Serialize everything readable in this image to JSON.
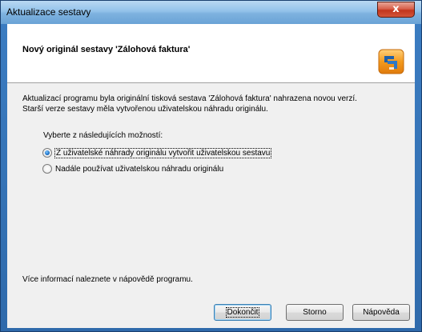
{
  "window": {
    "title": "Aktualizace sestavy",
    "close_glyph": "x"
  },
  "header": {
    "title": "Nový originál sestavy 'Zálohová faktura'",
    "logo_icon": "app-logo-icon"
  },
  "message": {
    "line1": "Aktualizací programu byla originální tisková sestava 'Zálohová faktura' nahrazena novou verzí.",
    "line2": "Starší verze sestavy měla vytvořenou uživatelskou náhradu originálu."
  },
  "options": {
    "label": "Vyberte z následujících možností:",
    "items": [
      {
        "label": "Z uživatelské náhrady originálu vytvořit uživatelskou sestavu",
        "selected": true
      },
      {
        "label": "Nadále používat uživatelskou náhradu originálu",
        "selected": false
      }
    ]
  },
  "info": "Více informací naleznete v nápovědě programu.",
  "buttons": {
    "finish": "Dokončit",
    "cancel": "Storno",
    "help": "Nápověda"
  },
  "colors": {
    "title_bar": "#7eb2df",
    "close_button": "#c2351c",
    "logo_orange": "#f39a1e",
    "logo_blue": "#1f5fa8"
  }
}
